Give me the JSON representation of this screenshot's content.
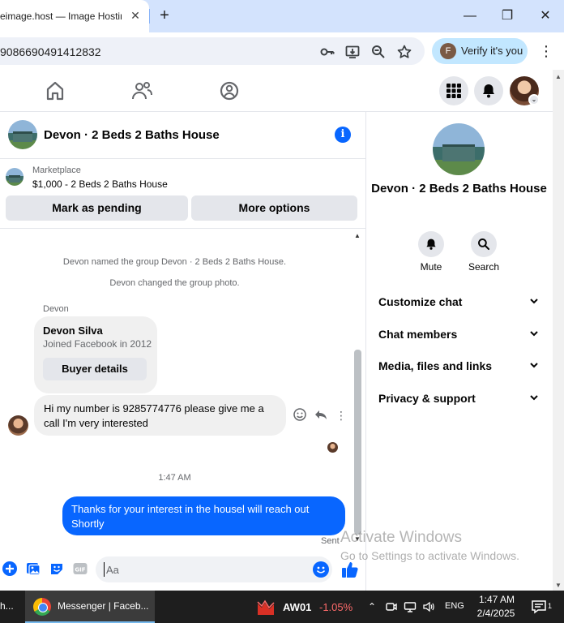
{
  "browser": {
    "tab_title": "eimage.host — Image Hostin",
    "tab_close_glyph": "✕",
    "new_tab_glyph": "+",
    "url": "9086690491412832",
    "verify_label": "Verify it's you",
    "verify_avatar_letter": "F",
    "window_minimize": "—",
    "window_maximize": "❐",
    "window_close": "✕"
  },
  "chat": {
    "title": "Devon · 2 Beds 2 Baths House",
    "info_glyph": "i",
    "listing": {
      "source": "Marketplace",
      "price_title": "$1,000 - 2 Beds 2 Baths House",
      "mark_pending": "Mark as pending",
      "more_options": "More options"
    },
    "system_messages": [
      "Devon named the group Devon · 2 Beds 2 Baths House.",
      "Devon changed the group photo."
    ],
    "sender_name": "Devon",
    "profile_card": {
      "name": "Devon Silva",
      "subtitle": "Joined Facebook in 2012",
      "button": "Buyer details"
    },
    "incoming_message": "Hi my number is 9285774776 please give me a call I'm very interested",
    "timestamp": "1:47 AM",
    "outgoing_message": "Thanks for your interest in the housel will reach out Shortly",
    "sent_label": "Sent",
    "composer_placeholder": "Aa"
  },
  "right_panel": {
    "title": "Devon · 2 Beds 2 Baths House",
    "actions": [
      {
        "label": "Mute",
        "icon": "bell-icon"
      },
      {
        "label": "Search",
        "icon": "search-icon"
      }
    ],
    "sections": [
      "Customize chat",
      "Chat members",
      "Media, files and links",
      "Privacy & support"
    ]
  },
  "watermark": {
    "line1": "Activate Windows",
    "line2": "Go to Settings to activate Windows."
  },
  "taskbar": {
    "left_fragment": "h...",
    "app_label": "Messenger | Faceb...",
    "stock_name": "AW01",
    "stock_change": "-1.05%",
    "language": "ENG",
    "time": "1:47 AM",
    "date": "2/4/2025",
    "notification_count": "1"
  },
  "colors": {
    "messenger_blue": "#0866ff",
    "tab_strip": "#d3e3fd",
    "verify_pill": "#c2e7ff",
    "stock_down": "#ff6b6b"
  }
}
